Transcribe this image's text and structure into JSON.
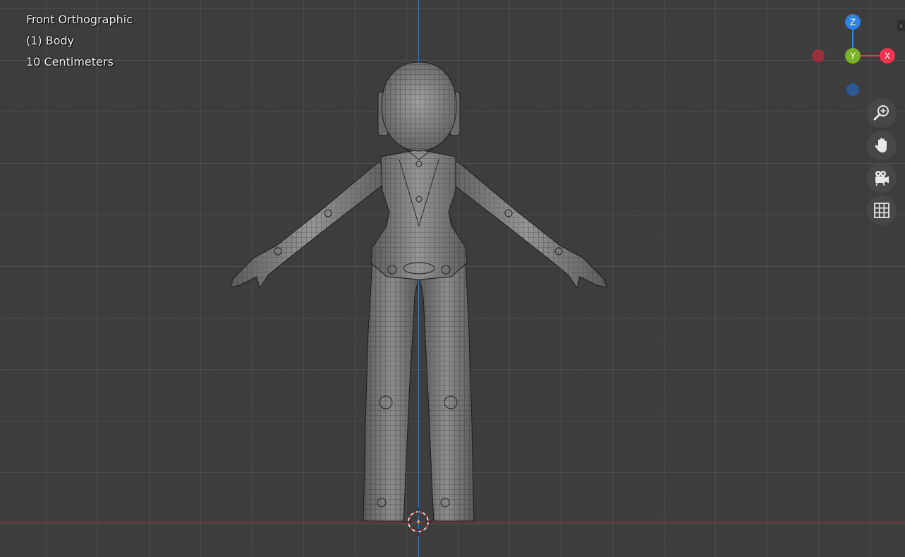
{
  "viewport": {
    "view_name": "Front Orthographic",
    "object_label": "(1) Body",
    "grid_scale": "10 Centimeters"
  },
  "gizmo": {
    "z_label": "Z",
    "y_label": "Y",
    "x_label": "X",
    "colors": {
      "z": "#2f80e8",
      "y": "#79b32a",
      "x": "#f0334f",
      "neg_x": "#9c2f3c",
      "neg_z": "#2d5a94"
    }
  },
  "nav_buttons": {
    "zoom_icon": "zoom-icon",
    "pan_icon": "hand-icon",
    "camera_icon": "camera-icon",
    "grid_icon": "grid-icon"
  },
  "sidebar_toggle": "‹"
}
